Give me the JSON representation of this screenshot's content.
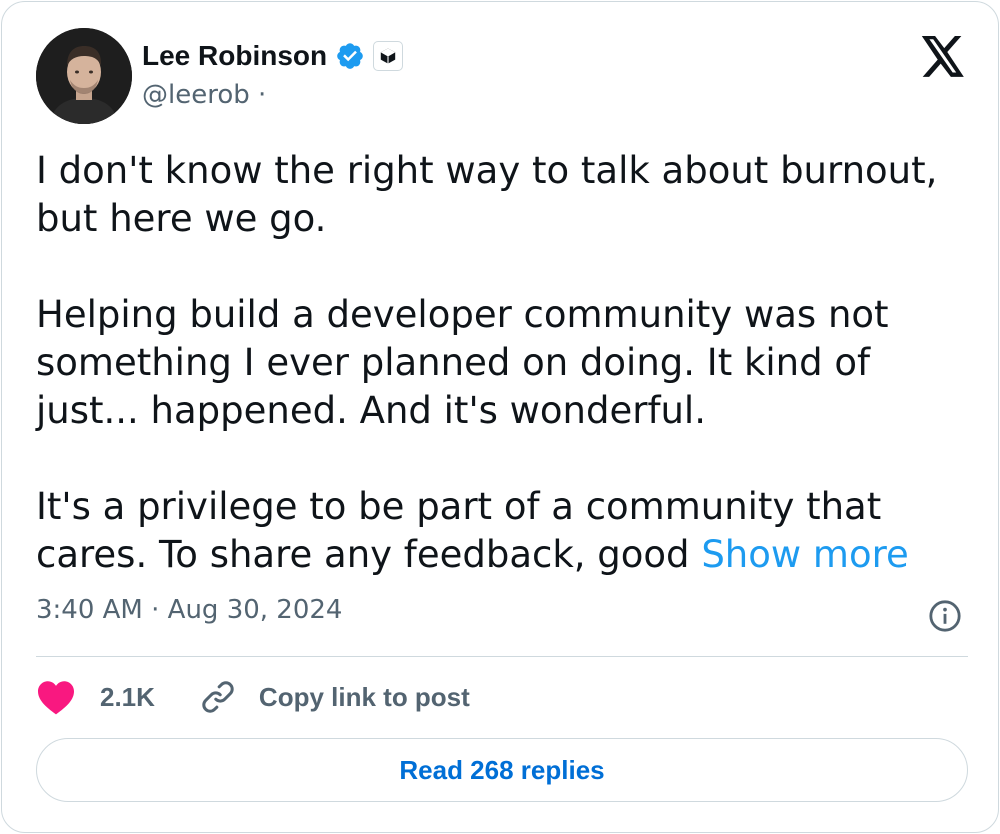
{
  "author": {
    "name": "Lee Robinson",
    "handle": "@leerob",
    "handle_separator": "·",
    "verified_icon": "verified-badge-icon",
    "affiliation_icon": "affiliate-badge-icon"
  },
  "platform_icon": "x-logo-icon",
  "tweet": {
    "lines": [
      "I don't know the right way to talk about burnout,",
      "but here we go.",
      "",
      "Helping build a developer community was not",
      "something I ever planned on doing. It kind of",
      "just... happened. And it's wonderful.",
      "",
      "It's a privilege to be part of a community that",
      "cares. To share any feedback, good"
    ],
    "show_more": "Show more"
  },
  "meta": {
    "timestamp": "3:40 AM · Aug 30, 2024"
  },
  "actions": {
    "like_count": "2.1K",
    "copy_link_label": "Copy link to post"
  },
  "footer": {
    "read_replies_label": "Read 268 replies"
  },
  "colors": {
    "accent": "#1d9bf0",
    "like": "#f91880",
    "muted": "#536471",
    "text": "#0f1419",
    "border": "#cfd9de"
  }
}
